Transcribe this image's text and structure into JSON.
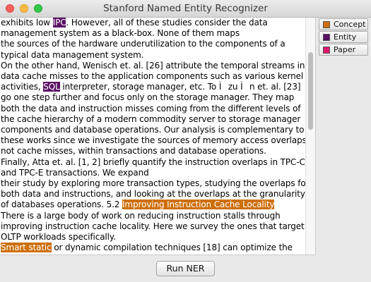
{
  "window": {
    "title": "Stanford Named Entity Recognizer"
  },
  "colors": {
    "Concept": "#cd6f0a",
    "Entity": "#5a0f63",
    "Paper": "#e0196b"
  },
  "legend": {
    "items": [
      {
        "label": "Concept",
        "color": "#cd6f0a"
      },
      {
        "label": "Entity",
        "color": "#5a0f63"
      },
      {
        "label": "Paper",
        "color": "#e0196b"
      }
    ]
  },
  "document": {
    "lines": [
      [
        {
          "t": "exhibits low "
        },
        {
          "t": "IPC",
          "type": "Entity"
        },
        {
          "t": ". However, all of these studies consider the data"
        }
      ],
      [
        {
          "t": "management system as a black-box. None of them maps"
        }
      ],
      [
        {
          "t": "the sources of the hardware underutilization to the components of a"
        }
      ],
      [
        {
          "t": "typical data management system."
        }
      ],
      [
        {
          "t": "On the other hand, Wenisch et. al. [26] attribute the temporal streams in"
        }
      ],
      [
        {
          "t": "data cache misses to the application components such as various kernel"
        }
      ],
      [
        {
          "t": "activities, "
        },
        {
          "t": "SQL",
          "type": "Entity"
        },
        {
          "t": " interpreter, storage manager, etc. To Ìzu Ìn et. al. [23]"
        }
      ],
      [
        {
          "t": "go one step further and focus only on the storage manager. They map"
        }
      ],
      [
        {
          "t": "both the data and instruction misses coming from the different levels of"
        }
      ],
      [
        {
          "t": "the cache hierarchy of a modern commodity server to storage manager"
        }
      ],
      [
        {
          "t": "components and database operations. Our analysis is complementary to"
        }
      ],
      [
        {
          "t": "these works since we investigate the sources of memory access overlaps"
        }
      ],
      [
        {
          "t": "not cache misses, within transactions and database operations."
        }
      ],
      [
        {
          "t": "Finally, Atta et. al. [1, 2] briefly quantify the instruction overlaps in TPC-C"
        }
      ],
      [
        {
          "t": "and TPC-E transactions. We expand"
        }
      ],
      [
        {
          "t": "their study by exploring more transaction types, studying the overlaps for"
        }
      ],
      [
        {
          "t": "both data and instructions, and looking at the overlaps at the granularity"
        }
      ],
      [
        {
          "t": "of databases operations. 5.2 "
        },
        {
          "t": "Improving Instruction Cache Locality",
          "type": "Concept"
        }
      ],
      [
        {
          "t": "There is a large body of work on reducing instruction stalls through"
        }
      ],
      [
        {
          "t": "improving instruction cache locality. Here we survey the ones that target"
        }
      ],
      [
        {
          "t": "OLTP workloads specifically."
        }
      ],
      [
        {
          "t": "Smart static",
          "type": "Concept"
        },
        {
          "t": " or dynamic compilation techniques [18] can optimize the"
        }
      ]
    ]
  },
  "run_button": {
    "label": "Run NER"
  }
}
